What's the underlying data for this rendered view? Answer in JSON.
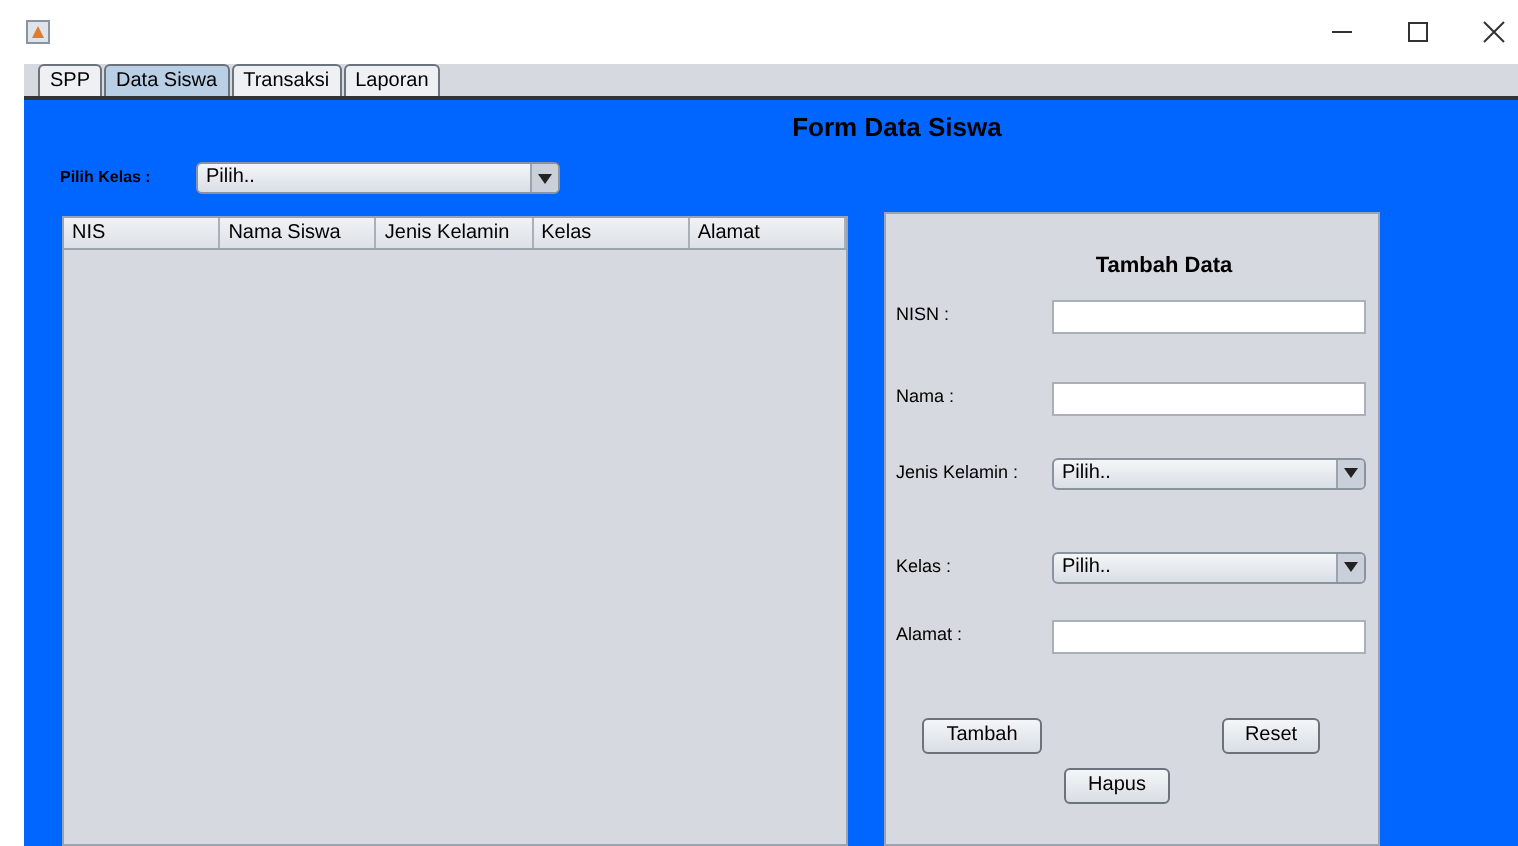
{
  "tabs": [
    {
      "label": "SPP",
      "selected": false
    },
    {
      "label": "Data Siswa",
      "selected": true
    },
    {
      "label": "Transaksi",
      "selected": false
    },
    {
      "label": "Laporan",
      "selected": false
    }
  ],
  "form_title": "Form Data Siswa",
  "class_filter": {
    "label": "Pilih Kelas :",
    "value": "Pilih.."
  },
  "table": {
    "columns": [
      "NIS",
      "Nama Siswa",
      "Jenis Kelamin",
      "Kelas",
      "Alamat"
    ]
  },
  "panel": {
    "title": "Tambah Data",
    "fields": [
      {
        "kind": "text",
        "label": "NISN :"
      },
      {
        "kind": "text",
        "label": "Nama :"
      },
      {
        "kind": "combo",
        "label": "Jenis Kelamin :",
        "value": "Pilih.."
      },
      {
        "kind": "combo",
        "label": "Kelas :",
        "value": "Pilih.."
      },
      {
        "kind": "text",
        "label": "Alamat :"
      }
    ],
    "buttons": [
      "Tambah",
      "Reset",
      "Hapus"
    ]
  }
}
